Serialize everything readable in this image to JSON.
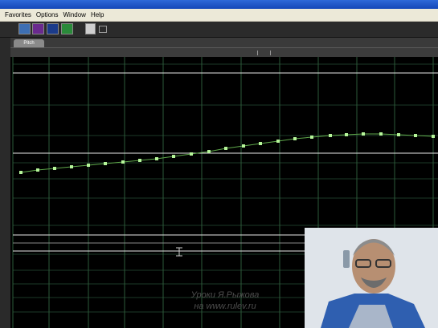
{
  "menu": {
    "items": [
      "Favorites",
      "Options",
      "Window",
      "Help"
    ]
  },
  "tabs": [
    {
      "label": "Pitch"
    }
  ],
  "watermark": {
    "line1": "Уроки Я.Рыжова",
    "line2": "на www.rulev.ru"
  },
  "colors": {
    "curve": "#b6f59a",
    "grid": "#2d5a3a",
    "guide": "#e8e8e8"
  },
  "icons": {
    "toolbar": [
      "waveform-view-icon",
      "purple-tool-icon",
      "blue-tool-icon",
      "green-tool-icon",
      "pointer-tool-icon"
    ]
  },
  "webcam": {
    "subject": "presenter-video"
  }
}
